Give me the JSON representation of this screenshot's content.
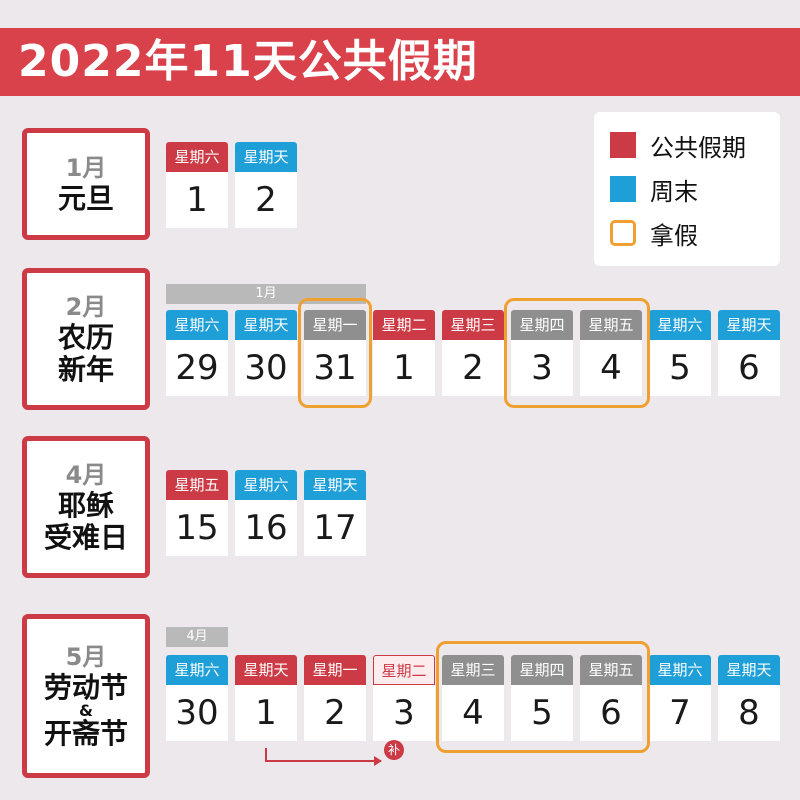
{
  "title": "2022年11天公共假期",
  "legend": {
    "items": [
      {
        "label": "公共假期",
        "color": "#cc3b45"
      },
      {
        "label": "周末",
        "color": "#1e9fd8"
      },
      {
        "label": "拿假",
        "color": "#f0a030"
      }
    ]
  },
  "sections": [
    {
      "month": "1月",
      "holiday": [
        "元旦"
      ],
      "days": [
        {
          "weekday": "星期六",
          "date": "1",
          "type": "holiday"
        },
        {
          "weekday": "星期天",
          "date": "2",
          "type": "weekend"
        }
      ]
    },
    {
      "month": "2月",
      "holiday": [
        "农历",
        "新年"
      ],
      "context_label": "1月",
      "days": [
        {
          "weekday": "星期六",
          "date": "29",
          "type": "weekend"
        },
        {
          "weekday": "星期天",
          "date": "30",
          "type": "weekend"
        },
        {
          "weekday": "星期一",
          "date": "31",
          "type": "leave"
        },
        {
          "weekday": "星期二",
          "date": "1",
          "type": "holiday"
        },
        {
          "weekday": "星期三",
          "date": "2",
          "type": "holiday"
        },
        {
          "weekday": "星期四",
          "date": "3",
          "type": "leave"
        },
        {
          "weekday": "星期五",
          "date": "4",
          "type": "leave"
        },
        {
          "weekday": "星期六",
          "date": "5",
          "type": "weekend"
        },
        {
          "weekday": "星期天",
          "date": "6",
          "type": "weekend"
        }
      ]
    },
    {
      "month": "4月",
      "holiday": [
        "耶稣",
        "受难日"
      ],
      "days": [
        {
          "weekday": "星期五",
          "date": "15",
          "type": "holiday"
        },
        {
          "weekday": "星期六",
          "date": "16",
          "type": "weekend"
        },
        {
          "weekday": "星期天",
          "date": "17",
          "type": "weekend"
        }
      ]
    },
    {
      "month": "5月",
      "holiday": [
        "劳动节",
        "&",
        "开斋节"
      ],
      "context_label": "4月",
      "makeup_badge": "补",
      "days": [
        {
          "weekday": "星期六",
          "date": "30",
          "type": "weekend"
        },
        {
          "weekday": "星期天",
          "date": "1",
          "type": "holiday"
        },
        {
          "weekday": "星期一",
          "date": "2",
          "type": "holiday"
        },
        {
          "weekday": "星期二",
          "date": "3",
          "type": "makeup"
        },
        {
          "weekday": "星期三",
          "date": "4",
          "type": "leave"
        },
        {
          "weekday": "星期四",
          "date": "5",
          "type": "leave"
        },
        {
          "weekday": "星期五",
          "date": "6",
          "type": "leave"
        },
        {
          "weekday": "星期六",
          "date": "7",
          "type": "weekend"
        },
        {
          "weekday": "星期天",
          "date": "8",
          "type": "weekend"
        }
      ]
    }
  ]
}
